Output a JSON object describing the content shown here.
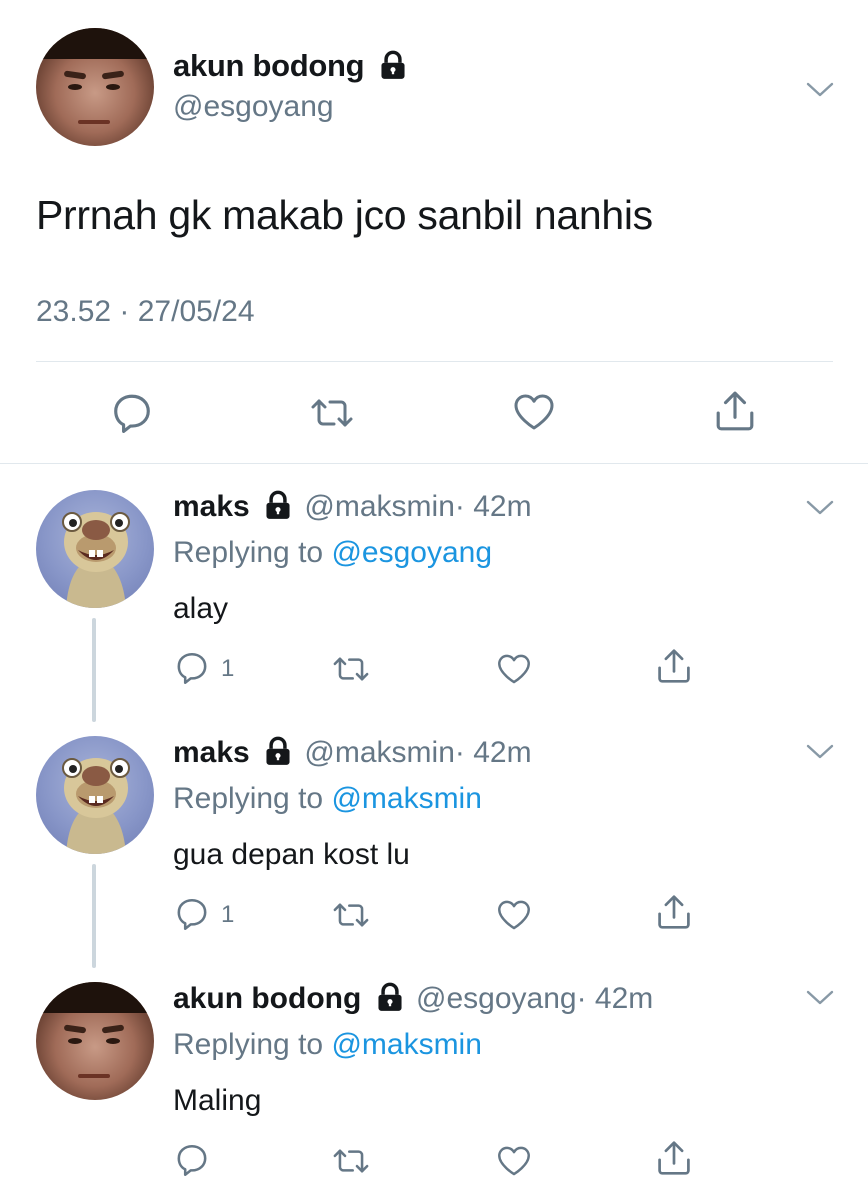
{
  "main_tweet": {
    "name": "akun bodong",
    "handle": "@esgoyang",
    "text": "Prrnah gk makab jco sanbil nanhis",
    "timestamp": "23.52 · 27/05/24",
    "icons": [
      "lock-icon",
      "chevron-down-icon",
      "reply-icon",
      "retweet-icon",
      "like-icon",
      "share-icon"
    ]
  },
  "replies": [
    {
      "name": "maks",
      "handle": "@maksmin",
      "time": "· 42m",
      "replying_prefix": "Replying to ",
      "replying_to": "@esgoyang",
      "text": "alay",
      "reply_count": "1"
    },
    {
      "name": "maks",
      "handle": "@maksmin",
      "time": "· 42m",
      "replying_prefix": "Replying to ",
      "replying_to": "@maksmin",
      "text": "gua depan kost lu",
      "reply_count": "1"
    },
    {
      "name": "akun bodong",
      "handle": "@esgoyang",
      "time": "· 42m",
      "replying_prefix": "Replying to ",
      "replying_to": "@maksmin",
      "text": "Maling",
      "reply_count": ""
    }
  ],
  "colors": {
    "text": "#14171a",
    "secondary": "#657786",
    "link": "#1b95e0",
    "divider": "#e1e8ed",
    "thread_line": "#ccd6dd"
  }
}
